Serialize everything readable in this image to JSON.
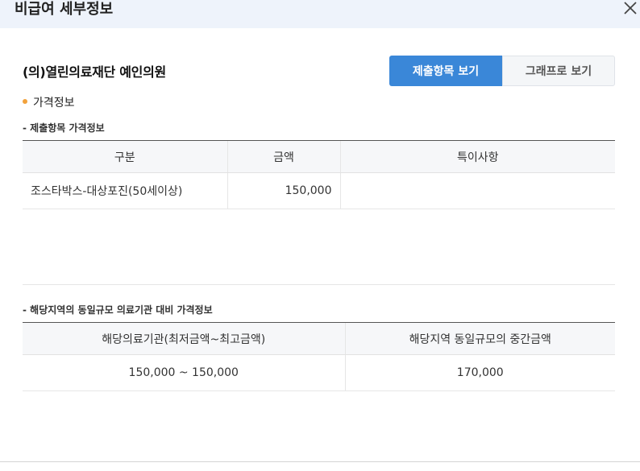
{
  "header": {
    "title": "비급여 세부정보"
  },
  "clinic": {
    "name": "(의)열린의료재단 예인의원"
  },
  "toggle": {
    "active_label": "제출항목 보기",
    "inactive_label": "그래프로 보기"
  },
  "section": {
    "title": "가격정보"
  },
  "submitted": {
    "label": "- 제출항목 가격정보",
    "columns": [
      "구분",
      "금액",
      "특이사항"
    ],
    "rows": [
      {
        "category": "조스타박스-대상포진(50세이상)",
        "amount": "150,000",
        "note": ""
      }
    ]
  },
  "regional": {
    "label": "- 해당지역의 동일규모 의료기관 대비 가격정보",
    "columns": [
      "해당의료기관(최저금액~최고금액)",
      "해당지역 동일규모의 중간금액"
    ],
    "rows": [
      {
        "range": "150,000 ~ 150,000",
        "median": "170,000"
      }
    ]
  },
  "colors": {
    "accent": "#3a87d8",
    "bullet": "#f2a23c",
    "header_bg": "#eef3fb"
  }
}
